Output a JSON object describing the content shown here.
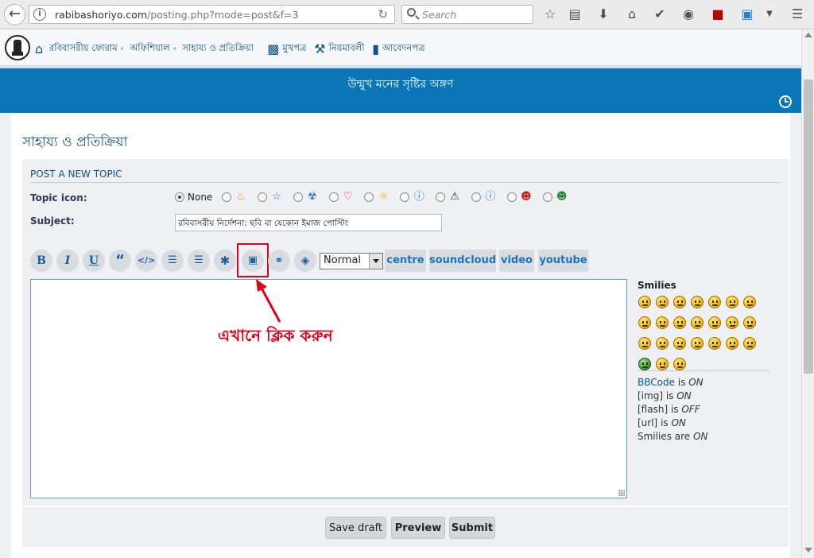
{
  "browser": {
    "url_host": "rabibashoriyo.com",
    "url_path": "/posting.php?mode=post&f=3",
    "search_placeholder": "Search"
  },
  "nav": {
    "crumbs": [
      "রবিবাসরীয় ফোরাম",
      "অফিশিয়াল",
      "সাহায্য ও প্রতিক্রিয়া"
    ],
    "links": [
      "মুখপত্র",
      "নিয়মাবলী",
      "আবেদনপত্র"
    ]
  },
  "banner": {
    "title": "উন্মুখ মনের সৃষ্টির অঙ্গণ"
  },
  "page": {
    "title": "সাহায্য ও প্রতিক্রিয়া"
  },
  "form": {
    "heading": "POST A NEW TOPIC",
    "topic_icon_label": "Topic icon:",
    "none_label": "None",
    "subject_label": "Subject:",
    "subject_value": "রবিবাসরীয় নির্দেশনা: ছবি বা যেকোন ইমাজ পোস্টিং",
    "font_size": "Normal",
    "custom_buttons": [
      "centre",
      "soundcloud",
      "video",
      "youtube"
    ],
    "annotation": "এখানে ক্লিক করুন",
    "annotation_color": "#e3001b"
  },
  "smilies": {
    "title": "Smilies",
    "count": 24
  },
  "status": {
    "bbcode_link": "BBCode",
    "bbcode_state": "ON",
    "img_label": "[img]",
    "img_state": "ON",
    "flash_label": "[flash]",
    "flash_state": "OFF",
    "url_label": "[url]",
    "url_state": "ON",
    "smilies_label": "Smilies are",
    "smilies_state": "ON"
  },
  "actions": {
    "save_draft": "Save draft",
    "preview": "Preview",
    "submit": "Submit"
  },
  "colors": {
    "banner": "#0a76b8",
    "link": "#105289"
  }
}
